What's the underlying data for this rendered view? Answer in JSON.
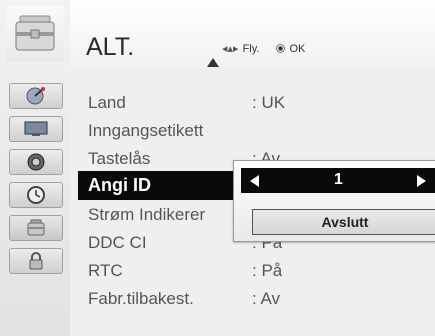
{
  "header": {
    "title": "ALT.",
    "nav_hint": "Fly.",
    "ok_hint": "OK"
  },
  "sidebar": {
    "items": [
      {
        "icon": "satellite-dish-icon"
      },
      {
        "icon": "screen-icon"
      },
      {
        "icon": "speaker-icon"
      },
      {
        "icon": "clock-icon"
      },
      {
        "icon": "toolbox-icon",
        "active": true
      },
      {
        "icon": "lock-icon"
      }
    ]
  },
  "menu": {
    "items": [
      {
        "label": "Land",
        "value": ": UK"
      },
      {
        "label": "Inngangsetikett",
        "value": ""
      },
      {
        "label": "Tastelås",
        "value": ": Av"
      },
      {
        "label": "Angi ID",
        "value": "",
        "selected": true
      },
      {
        "label": "Strøm Indikerer",
        "value": ""
      },
      {
        "label": "DDC CI",
        "value": ": På"
      },
      {
        "label": "RTC",
        "value": ": På"
      },
      {
        "label": "Fabr.tilbakest.",
        "value": ": Av"
      }
    ]
  },
  "popup": {
    "value": "1",
    "close_label": "Avslutt"
  },
  "colors": {
    "selected_bg": "#0a0a0a",
    "selected_text": "#ffffff",
    "panel_bg": "#efefef"
  }
}
